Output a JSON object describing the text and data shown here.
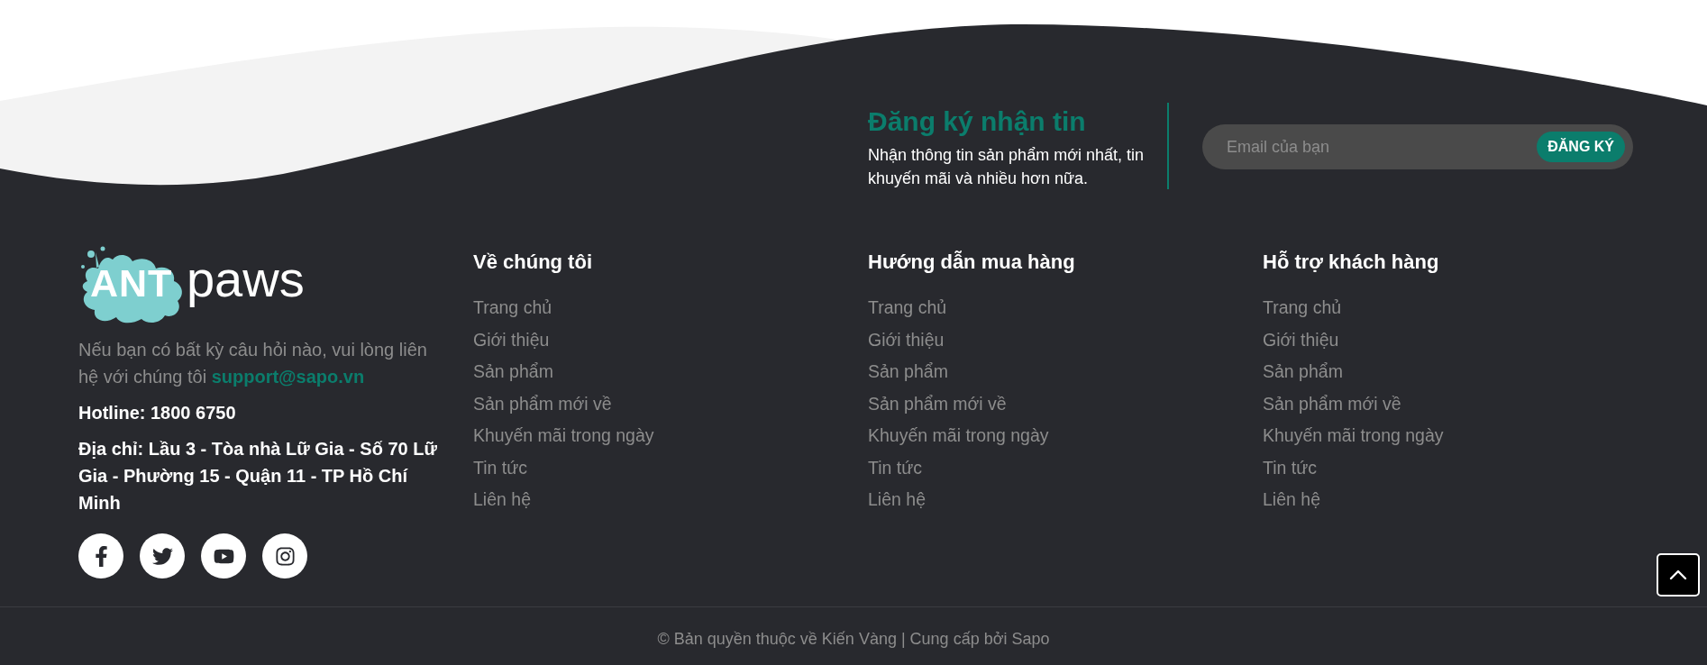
{
  "newsletter": {
    "title": "Đăng ký nhận tin",
    "description": "Nhận thông tin sản phẩm mới nhất, tin khuyến mãi và nhiều hơn nữa.",
    "email_field": {
      "placeholder": "Email của bạn"
    },
    "button": "ĐĂNG KÝ"
  },
  "logo": {
    "text_1": "ANT",
    "text_2": "paws"
  },
  "contact": {
    "description": "Nếu bạn có bất kỳ câu hỏi nào, vui lòng liên hệ với chúng tôi",
    "email_link": "support@sapo.vn",
    "hotline": "Hotline: 1800 6750",
    "address": "Địa chỉ: Lầu 3 - Tòa nhà Lữ Gia - Số 70 Lữ Gia - Phường 15 - Quận 11 - TP Hồ Chí Minh"
  },
  "social_links": [
    {
      "kind": "facebook"
    },
    {
      "kind": "twitter"
    },
    {
      "kind": "youtube"
    },
    {
      "kind": "instagram"
    }
  ],
  "link_columns": [
    {
      "title": "Về chúng tôi",
      "links": [
        "Trang chủ",
        "Giới thiệu",
        "Sản phẩm",
        "Sản phẩm mới về",
        "Khuyến mãi trong ngày",
        "Tin tức",
        "Liên hệ"
      ]
    },
    {
      "title": "Hướng dẫn mua hàng",
      "links": [
        "Trang chủ",
        "Giới thiệu",
        "Sản phẩm",
        "Sản phẩm mới về",
        "Khuyến mãi trong ngày",
        "Tin tức",
        "Liên hệ"
      ]
    },
    {
      "title": "Hỗ trợ khách hàng",
      "links": [
        "Trang chủ",
        "Giới thiệu",
        "Sản phẩm",
        "Sản phẩm mới về",
        "Khuyến mãi trong ngày",
        "Tin tức",
        "Liên hệ"
      ]
    }
  ],
  "copyright": "© Bản quyền thuộc về Kiến Vàng | Cung cấp bởi Sapo",
  "back_to_top": {
    "visible": true
  }
}
